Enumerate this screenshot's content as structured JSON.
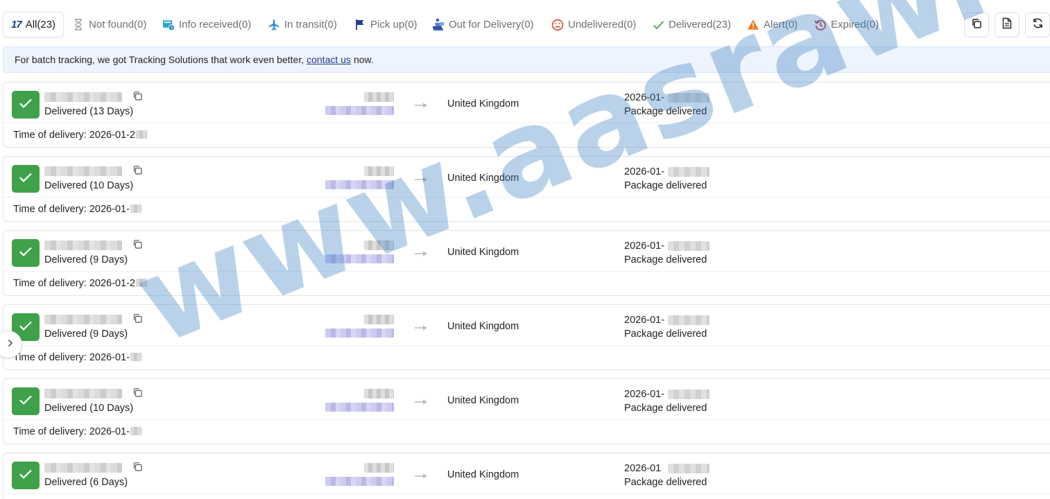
{
  "tabs": [
    {
      "id": "all",
      "label": "All",
      "count": "(23)",
      "icon": "logo-17-icon"
    },
    {
      "id": "not-found",
      "label": "Not found",
      "count": "(0)",
      "icon": "hourglass-icon"
    },
    {
      "id": "info-received",
      "label": "Info received",
      "count": "(0)",
      "icon": "info-received-icon"
    },
    {
      "id": "in-transit",
      "label": "In transit",
      "count": "(0)",
      "icon": "airplane-icon"
    },
    {
      "id": "pick-up",
      "label": "Pick up",
      "count": "(0)",
      "icon": "flag-icon"
    },
    {
      "id": "out-for-delivery",
      "label": "Out for Delivery",
      "count": "(0)",
      "icon": "delivery-person-icon"
    },
    {
      "id": "undelivered",
      "label": "Undelivered",
      "count": "(0)",
      "icon": "sad-face-icon"
    },
    {
      "id": "delivered",
      "label": "Delivered",
      "count": "(23)",
      "icon": "check-icon"
    },
    {
      "id": "alert",
      "label": "Alert",
      "count": "(0)",
      "icon": "warning-icon"
    },
    {
      "id": "expired",
      "label": "Expired",
      "count": "(0)",
      "icon": "history-icon"
    }
  ],
  "logo_text": "17",
  "toolbar": [
    "copy-icon",
    "document-icon",
    "refresh-icon"
  ],
  "notice": {
    "before": "For batch tracking, we got Tracking Solutions that work even better,",
    "link": "contact us",
    "after": "now."
  },
  "colors": {
    "delivered_green": "#3fa24a",
    "alert_orange": "#f07c1a",
    "expired_red": "#c33a3a",
    "brand_blue": "#1d3b8c",
    "watermark_blue": "#2f78c0"
  },
  "shipments": [
    {
      "status": "Delivered (13 Days)",
      "destination": "United Kingdom",
      "date_prefix": "2026-01-",
      "latest_event": "Package delivered",
      "delivery_time": "Time of delivery: 2026-01-2"
    },
    {
      "status": "Delivered (10 Days)",
      "destination": "United Kingdom",
      "date_prefix": "2026-01-",
      "latest_event": "Package delivered",
      "delivery_time": "Time of delivery: 2026-01-"
    },
    {
      "status": "Delivered (9 Days)",
      "destination": "United Kingdom",
      "date_prefix": "2026-01-",
      "latest_event": "Package delivered",
      "delivery_time": "Time of delivery: 2026-01-2"
    },
    {
      "status": "Delivered (9 Days)",
      "destination": "United Kingdom",
      "date_prefix": "2026-01-",
      "latest_event": "Package delivered",
      "delivery_time": "Time of delivery: 2026-01-"
    },
    {
      "status": "Delivered (10 Days)",
      "destination": "United Kingdom",
      "date_prefix": "2026-01-",
      "latest_event": "Package delivered",
      "delivery_time": "Time of delivery: 2026-01-"
    },
    {
      "status": "Delivered (6 Days)",
      "destination": "United Kingdom",
      "date_prefix": "2026-01",
      "latest_event": "Package delivered",
      "delivery_time": ""
    }
  ],
  "watermark": "www.aasraw.co"
}
